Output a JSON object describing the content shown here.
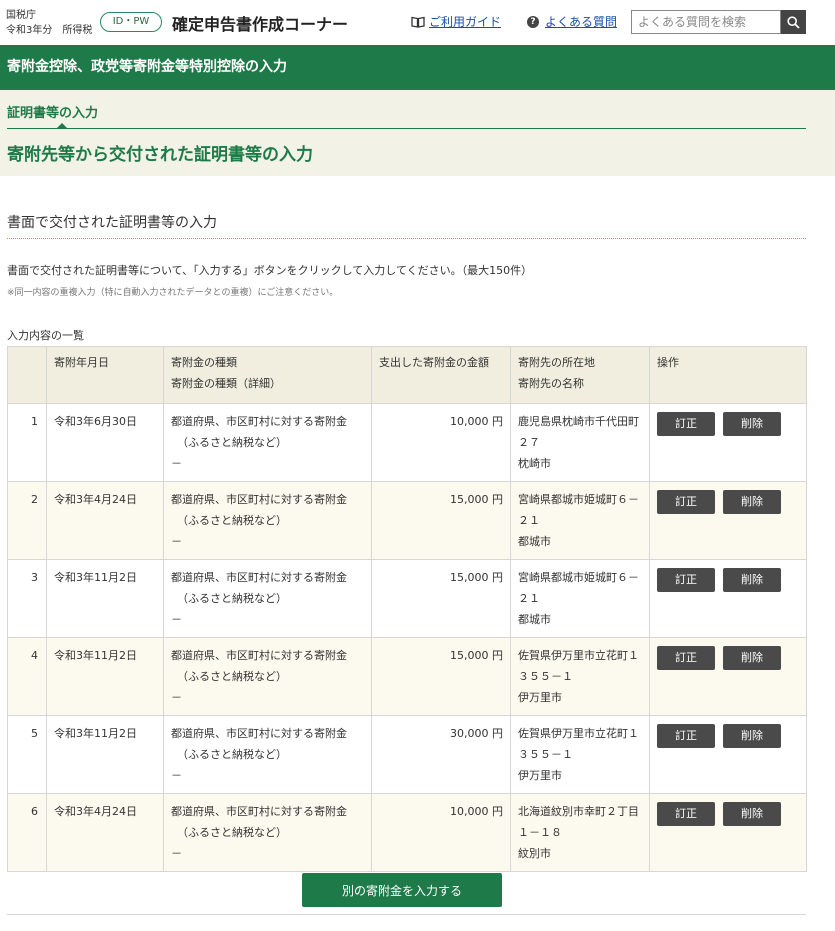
{
  "header": {
    "agency": "国税庁",
    "year": "令和3年分　所得税",
    "idpw_badge": "ID・PW",
    "title": "確定申告書作成コーナー",
    "guide_link": "ご利用ガイド",
    "faq_link": "よくある質問",
    "search_placeholder": "よくある質問を検索"
  },
  "banner": {
    "title": "寄附金控除、政党等寄附金等特別控除の入力"
  },
  "step": {
    "label": "証明書等の入力",
    "page_title": "寄附先等から交付された証明書等の入力"
  },
  "content": {
    "section_title": "書面で交付された証明書等の入力",
    "instruction": "書面で交付された証明書等について、「入力する」ボタンをクリックして入力してください。（最大150件）",
    "note": "※同一内容の重複入力（特に自動入力されたデータとの重複）にご注意ください。",
    "list_label": "入力内容の一覧"
  },
  "table": {
    "headers": {
      "date": "寄附年月日",
      "type": "寄附金の種類",
      "type_detail": "寄附金の種類（詳細）",
      "amount": "支出した寄附金の金額",
      "address": "寄附先の所在地",
      "name": "寄附先の名称",
      "ops": "操作"
    },
    "rows": [
      {
        "no": "1",
        "date": "令和3年6月30日",
        "type": "都道府県、市区町村に対する寄附金",
        "type_sub": "（ふるさと納税など）",
        "detail": "－",
        "amount": "10,000 円",
        "address": "鹿児島県枕崎市千代田町２７",
        "name": "枕崎市"
      },
      {
        "no": "2",
        "date": "令和3年4月24日",
        "type": "都道府県、市区町村に対する寄附金",
        "type_sub": "（ふるさと納税など）",
        "detail": "－",
        "amount": "15,000 円",
        "address": "宮崎県都城市姫城町６－２１",
        "name": "都城市"
      },
      {
        "no": "3",
        "date": "令和3年11月2日",
        "type": "都道府県、市区町村に対する寄附金",
        "type_sub": "（ふるさと納税など）",
        "detail": "－",
        "amount": "15,000 円",
        "address": "宮崎県都城市姫城町６－２１",
        "name": "都城市"
      },
      {
        "no": "4",
        "date": "令和3年11月2日",
        "type": "都道府県、市区町村に対する寄附金",
        "type_sub": "（ふるさと納税など）",
        "detail": "－",
        "amount": "15,000 円",
        "address": "佐賀県伊万里市立花町１３５５－１",
        "name": "伊万里市"
      },
      {
        "no": "5",
        "date": "令和3年11月2日",
        "type": "都道府県、市区町村に対する寄附金",
        "type_sub": "（ふるさと納税など）",
        "detail": "－",
        "amount": "30,000 円",
        "address": "佐賀県伊万里市立花町１３５５－１",
        "name": "伊万里市"
      },
      {
        "no": "6",
        "date": "令和3年4月24日",
        "type": "都道府県、市区町村に対する寄附金",
        "type_sub": "（ふるさと納税など）",
        "detail": "－",
        "amount": "10,000 円",
        "address": "北海道紋別市幸町２丁目１－１８",
        "name": "紋別市"
      }
    ],
    "edit_label": "訂正",
    "delete_label": "削除"
  },
  "add_button": "別の寄附金を入力する",
  "colors": {
    "primary_green": "#1e7a48",
    "beige": "#f3f2e6",
    "link_blue": "#1a4fa8",
    "button_gray": "#4a4a4a"
  },
  "icons": [
    "book-icon",
    "question-icon",
    "search-icon"
  ]
}
